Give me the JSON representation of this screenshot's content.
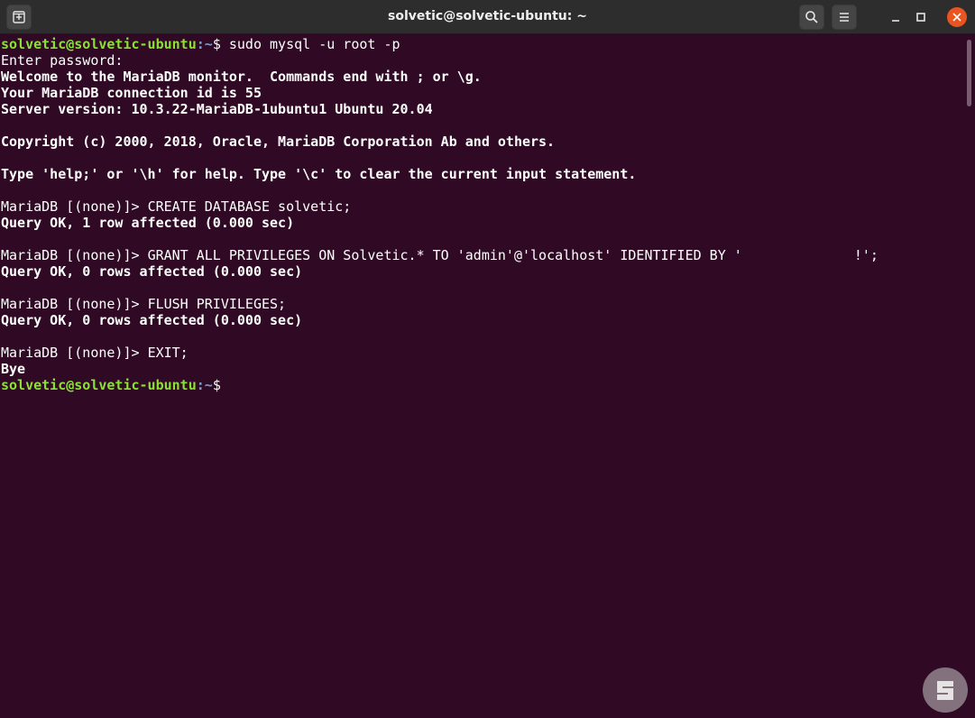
{
  "window": {
    "title": "solvetic@solvetic-ubuntu: ~"
  },
  "prompt": {
    "user": "solvetic@solvetic-ubuntu",
    "path": ":~",
    "symbol": "$ "
  },
  "terminal": {
    "cmd1": "sudo mysql -u root -p",
    "enter_password": "Enter password:",
    "welcome": "Welcome to the MariaDB monitor.  Commands end with ; or \\g.",
    "conn_id": "Your MariaDB connection id is 55",
    "server_version": "Server version: 10.3.22-MariaDB-1ubuntu1 Ubuntu 20.04",
    "copyright": "Copyright (c) 2000, 2018, Oracle, MariaDB Corporation Ab and others.",
    "help": "Type 'help;' or '\\h' for help. Type '\\c' to clear the current input statement.",
    "mariadb_prompt": "MariaDB [(none)]> ",
    "q1_cmd": "CREATE DATABASE solvetic;",
    "q1_result": "Query OK, 1 row affected (0.000 sec)",
    "q2_cmd_a": "GRANT ALL PRIVILEGES ON Solvetic.* TO 'admin'@'localhost' IDENTIFIED BY '",
    "q2_cmd_b": "!';",
    "q2_result": "Query OK, 0 rows affected (0.000 sec)",
    "q3_cmd": "FLUSH PRIVILEGES;",
    "q3_result": "Query OK, 0 rows affected (0.000 sec)",
    "q4_cmd": "EXIT;",
    "bye": "Bye"
  },
  "colors": {
    "terminal_bg": "#300a24",
    "prompt_user": "#8ae234",
    "prompt_path": "#729fcf",
    "close_button": "#e95420"
  },
  "icons": [
    "new-tab-icon",
    "search-icon",
    "hamburger-menu-icon",
    "minimize-icon",
    "maximize-icon",
    "close-icon"
  ]
}
